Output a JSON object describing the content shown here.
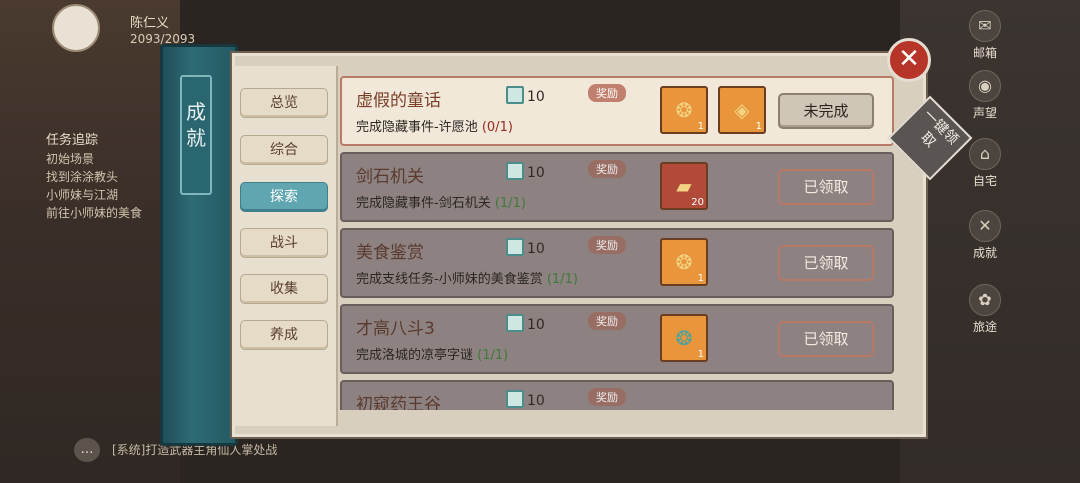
{
  "hud": {
    "player_name": "陈仁义",
    "hp": "2093/2093"
  },
  "quest_tracker": {
    "title": "任务追踪",
    "line1": "初始场景",
    "line2": "找到涂涂教头",
    "line3": "小师妹与江湖",
    "line4": "前往小师妹的美食"
  },
  "chat": {
    "icon": "…",
    "text": "[系统]打造武器主角仙人掌处战"
  },
  "side_menu": {
    "mail": "邮箱",
    "reputation": "声望",
    "home": "自宅",
    "achievement": "成就",
    "travel": "旅途"
  },
  "panel": {
    "spine_title": "成\n就",
    "tabs": [
      {
        "label": "总览"
      },
      {
        "label": "综合"
      },
      {
        "label": "探索"
      },
      {
        "label": "战斗"
      },
      {
        "label": "收集"
      },
      {
        "label": "养成"
      }
    ],
    "active_tab": "探索",
    "close_label": "✕",
    "claim_all_label": "一键领取"
  },
  "achievements": [
    {
      "title": "虚假的童话",
      "points": "10",
      "reward_label": "奖励",
      "desc": "完成隐藏事件-许愿池",
      "progress": "(0/1)",
      "status": "未完成",
      "rewards": [
        {
          "name": "charm-orange",
          "qty": "1"
        },
        {
          "name": "coin",
          "qty": "1"
        }
      ]
    },
    {
      "title": "剑石机关",
      "points": "10",
      "reward_label": "奖励",
      "desc": "完成隐藏事件-剑石机关",
      "progress": "(1/1)",
      "status": "已领取",
      "rewards": [
        {
          "name": "gold-ingot",
          "qty": "20"
        }
      ]
    },
    {
      "title": "美食鉴赏",
      "points": "10",
      "reward_label": "奖励",
      "desc": "完成支线任务-小师妹的美食鉴赏",
      "progress": "(1/1)",
      "status": "已领取",
      "rewards": [
        {
          "name": "charm-orange",
          "qty": "1"
        }
      ]
    },
    {
      "title": "才高八斗3",
      "points": "10",
      "reward_label": "奖励",
      "desc": "完成洛城的凉亭字谜",
      "progress": "(1/1)",
      "status": "已领取",
      "rewards": [
        {
          "name": "charm-teal",
          "qty": "1"
        }
      ]
    },
    {
      "title": "初窥药王谷",
      "points": "10",
      "reward_label": "奖励",
      "desc": "",
      "progress": "",
      "status": "",
      "rewards": []
    }
  ]
}
